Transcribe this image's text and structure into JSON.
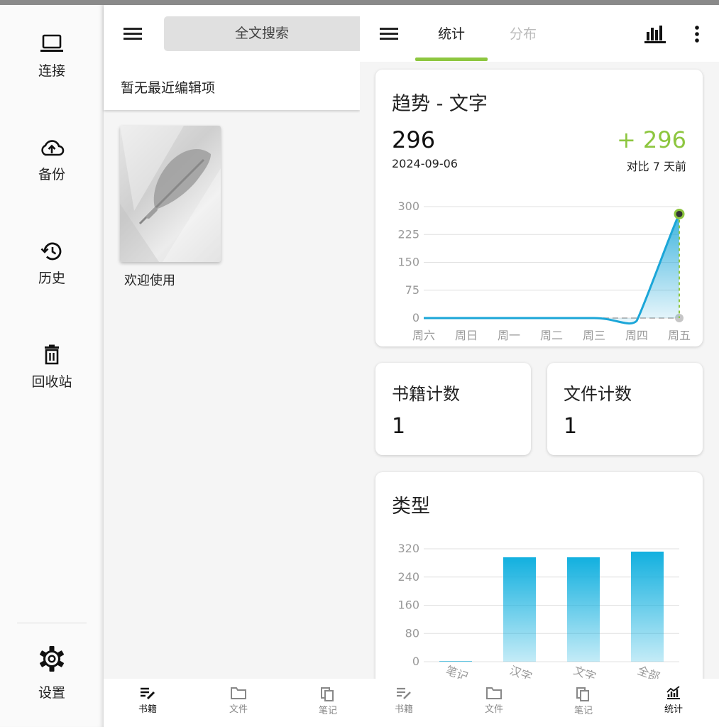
{
  "rail": {
    "items": [
      {
        "label": "连接",
        "icon": "laptop-icon"
      },
      {
        "label": "备份",
        "icon": "cloud-upload-icon"
      },
      {
        "label": "历史",
        "icon": "history-icon"
      },
      {
        "label": "回收站",
        "icon": "trash-icon"
      }
    ],
    "settings": {
      "label": "设置",
      "icon": "gear-icon"
    }
  },
  "books_panel": {
    "search_placeholder": "全文搜索",
    "recent_text": "暂无最近编辑项",
    "books": [
      {
        "title": "欢迎使用"
      }
    ]
  },
  "stats_panel": {
    "tabs": [
      {
        "label": "统计",
        "active": true
      },
      {
        "label": "分布",
        "active": false
      }
    ],
    "trend_card": {
      "title": "趋势 - 文字",
      "value": "296",
      "date": "2024-09-06",
      "delta": "+ 296",
      "compare": "对比 7 天前"
    },
    "book_count": {
      "title": "书籍计数",
      "value": "1"
    },
    "file_count": {
      "title": "文件计数",
      "value": "1"
    },
    "type_card": {
      "title": "类型"
    }
  },
  "bottom_nav": [
    {
      "label": "书籍",
      "active": true
    },
    {
      "label": "文件",
      "active": false
    },
    {
      "label": "笔记",
      "active": false
    },
    {
      "label": "书籍",
      "active": false
    },
    {
      "label": "文件",
      "active": false
    },
    {
      "label": "笔记",
      "active": false
    },
    {
      "label": "统计",
      "active": true
    }
  ],
  "colors": {
    "accent": "#8dc63f",
    "chart_blue": "#1ba6d8",
    "bar_blue": "#12b0df"
  },
  "chart_data": [
    {
      "type": "area",
      "title": "趋势 - 文字",
      "categories": [
        "周六",
        "周日",
        "周一",
        "周二",
        "周三",
        "周四",
        "周五"
      ],
      "values": [
        0,
        0,
        0,
        0,
        0,
        0,
        280
      ],
      "yticks": [
        0,
        75,
        150,
        225,
        300
      ],
      "ylim": [
        0,
        300
      ],
      "grid": true
    },
    {
      "type": "bar",
      "title": "类型",
      "categories": [
        "笔记",
        "汉字",
        "文字",
        "全部"
      ],
      "values": [
        0,
        296,
        296,
        312
      ],
      "yticks": [
        0,
        80,
        160,
        240,
        320
      ],
      "ylim": [
        0,
        320
      ],
      "grid": true
    }
  ]
}
